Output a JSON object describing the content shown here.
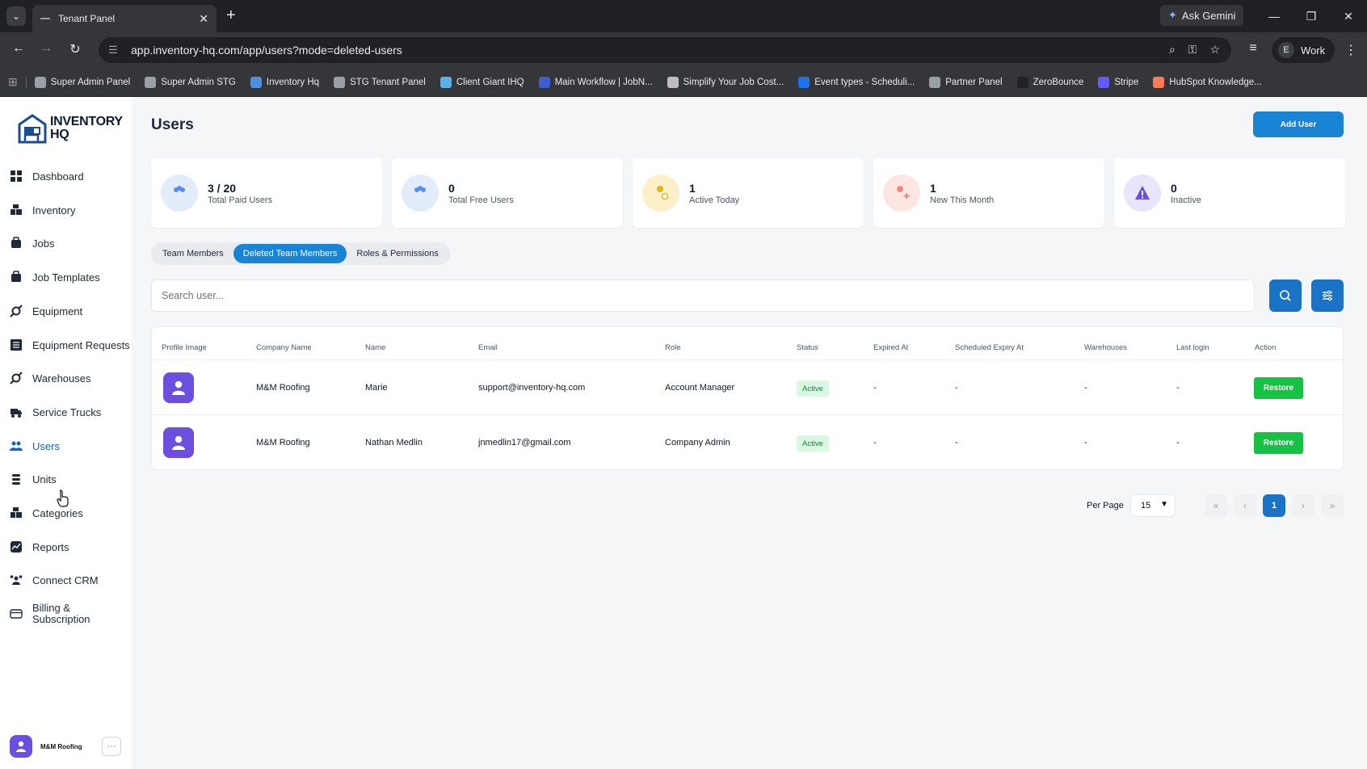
{
  "browser": {
    "tab_title": "Tenant Panel",
    "ask_gemini": "Ask Gemini",
    "url": "app.inventory-hq.com/app/users?mode=deleted-users",
    "profile_letter": "E",
    "profile_name": "Work",
    "bookmarks": [
      {
        "label": "Super Admin Panel",
        "color": "#9aa0a6"
      },
      {
        "label": "Super Admin STG",
        "color": "#9aa0a6"
      },
      {
        "label": "Inventory Hq",
        "color": "#4f8de0"
      },
      {
        "label": "STG Tenant Panel",
        "color": "#9aa0a6"
      },
      {
        "label": "Client Giant IHQ",
        "color": "#5ab0e8"
      },
      {
        "label": "Main Workflow | JobN...",
        "color": "#3a5fd0"
      },
      {
        "label": "Simplify Your Job Cost...",
        "color": "#bdbdbd"
      },
      {
        "label": "Event types - Scheduli...",
        "color": "#1a73e8"
      },
      {
        "label": "Partner Panel",
        "color": "#9aa0a6"
      },
      {
        "label": "ZeroBounce",
        "color": "#222222"
      },
      {
        "label": "Stripe",
        "color": "#635bff"
      },
      {
        "label": "HubSpot Knowledge...",
        "color": "#ff7a59"
      }
    ]
  },
  "brand": {
    "line1": "INVENTORY",
    "line2": "HQ"
  },
  "sidebar": {
    "items": [
      {
        "label": "Dashboard",
        "icon": "dashboard-icon"
      },
      {
        "label": "Inventory",
        "icon": "inventory-icon"
      },
      {
        "label": "Jobs",
        "icon": "jobs-icon"
      },
      {
        "label": "Job Templates",
        "icon": "job-templates-icon"
      },
      {
        "label": "Equipment",
        "icon": "equipment-icon"
      },
      {
        "label": "Equipment Requests",
        "icon": "equipment-requests-icon"
      },
      {
        "label": "Warehouses",
        "icon": "warehouses-icon"
      },
      {
        "label": "Service Trucks",
        "icon": "truck-icon"
      },
      {
        "label": "Users",
        "icon": "users-icon"
      },
      {
        "label": "Units",
        "icon": "units-icon"
      },
      {
        "label": "Categories",
        "icon": "categories-icon"
      },
      {
        "label": "Reports",
        "icon": "reports-icon"
      },
      {
        "label": "Connect CRM",
        "icon": "crm-icon"
      },
      {
        "label": "Billing & Subscription",
        "icon": "billing-icon"
      }
    ],
    "footer_name": "M&M Roofing",
    "footer_more": "···"
  },
  "header": {
    "title": "Users",
    "add_button": "Add User"
  },
  "stats": [
    {
      "value": "3 / 20",
      "label": "Total Paid Users",
      "bg": "#e3ecfb",
      "fg": "#5b8def"
    },
    {
      "value": "0",
      "label": "Total Free Users",
      "bg": "#e3ecfb",
      "fg": "#5b8def"
    },
    {
      "value": "1",
      "label": "Active Today",
      "bg": "#fdf0c9",
      "fg": "#e7b417"
    },
    {
      "value": "1",
      "label": "New This Month",
      "bg": "#fde6e2",
      "fg": "#ef8a78"
    },
    {
      "value": "0",
      "label": "Inactive",
      "bg": "#e9e6fb",
      "fg": "#6d4fe0"
    }
  ],
  "tabs": [
    "Team Members",
    "Deleted Team Members",
    "Roles & Permissions"
  ],
  "search": {
    "placeholder": "Search user..."
  },
  "table": {
    "headers": [
      "Profile Image",
      "Company Name",
      "Name",
      "Email",
      "Role",
      "Status",
      "Expired At",
      "Scheduled Expiry At",
      "Warehouses",
      "Last login",
      "Action"
    ],
    "rows": [
      {
        "company": "M&M Roofing",
        "name": "Marie",
        "email": "support@inventory-hq.com",
        "role": "Account Manager",
        "status": "Active",
        "expired": "-",
        "scheduled": "-",
        "warehouses": "-",
        "last_login": "-",
        "action": "Restore"
      },
      {
        "company": "M&M Roofing",
        "name": "Nathan Medlin",
        "email": "jnmedlin17@gmail.com",
        "role": "Company Admin",
        "status": "Active",
        "expired": "-",
        "scheduled": "-",
        "warehouses": "-",
        "last_login": "-",
        "action": "Restore"
      }
    ]
  },
  "pagination": {
    "per_page_label": "Per Page",
    "per_page": "15",
    "first": "«",
    "prev": "‹",
    "current": "1",
    "next": "›",
    "last": "»"
  },
  "colors": {
    "accent": "#1a84d4",
    "restore": "#16c244",
    "active_badge_bg": "#d9f7e2",
    "avatar": "#6d4fe0"
  }
}
